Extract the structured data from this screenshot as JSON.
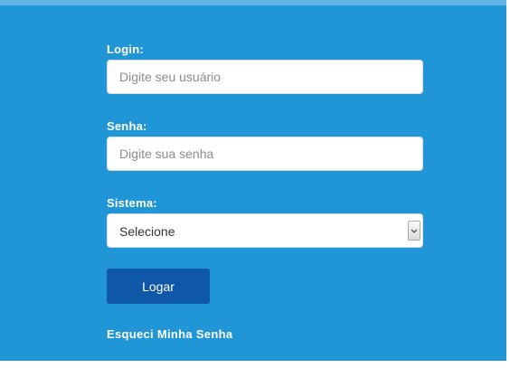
{
  "login": {
    "label": "Login:",
    "placeholder": "Digite seu usuário",
    "value": ""
  },
  "password": {
    "label": "Senha:",
    "placeholder": "Digite sua senha",
    "value": ""
  },
  "system": {
    "label": "Sistema:",
    "selected": "Selecione"
  },
  "actions": {
    "login_button": "Logar",
    "forgot_password": "Esqueci Minha Senha"
  },
  "colors": {
    "panel_background": "#2196d7",
    "button_background": "#0f58a8",
    "text": "#ffffff"
  },
  "icons": {
    "select_arrow": "chevron-down-icon"
  }
}
